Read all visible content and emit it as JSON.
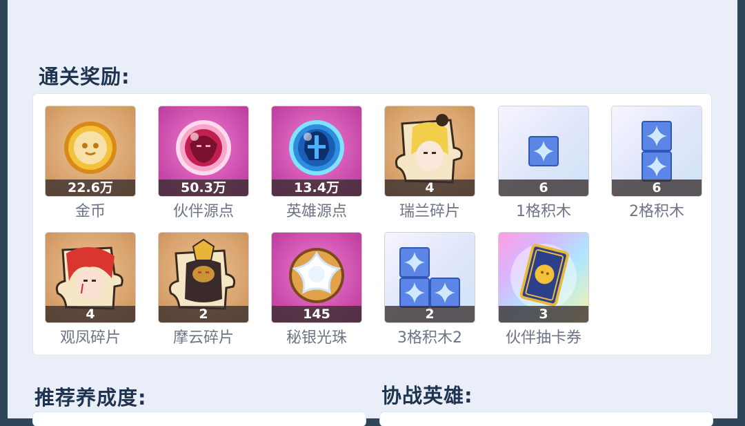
{
  "rewards_title": "通关奖励:",
  "rewards": [
    {
      "name": "金币",
      "qty": "22.6万",
      "icon": "gold-coin-icon",
      "bg": "orange"
    },
    {
      "name": "伙伴源点",
      "qty": "50.3万",
      "icon": "partner-orb-icon",
      "bg": "pink"
    },
    {
      "name": "英雄源点",
      "qty": "13.4万",
      "icon": "hero-orb-icon",
      "bg": "pink"
    },
    {
      "name": "瑞兰碎片",
      "qty": "4",
      "icon": "ruilan-fragment-icon",
      "bg": "orange"
    },
    {
      "name": "1格积木",
      "qty": "6",
      "icon": "block-1-icon",
      "bg": "light"
    },
    {
      "name": "2格积木",
      "qty": "6",
      "icon": "block-2-icon",
      "bg": "light"
    },
    {
      "name": "观凤碎片",
      "qty": "4",
      "icon": "guanfeng-fragment-icon",
      "bg": "orange"
    },
    {
      "name": "摩云碎片",
      "qty": "2",
      "icon": "moyun-fragment-icon",
      "bg": "orange"
    },
    {
      "name": "秘银光珠",
      "qty": "145",
      "icon": "mithril-pearl-icon",
      "bg": "pink"
    },
    {
      "name": "3格积木2",
      "qty": "2",
      "icon": "block-3-icon",
      "bg": "light"
    },
    {
      "name": "伙伴抽卡券",
      "qty": "3",
      "icon": "partner-card-ticket-icon",
      "bg": "rainbow"
    }
  ],
  "recommend_title": "推荐养成度:",
  "assist_title": "协战英雄:"
}
